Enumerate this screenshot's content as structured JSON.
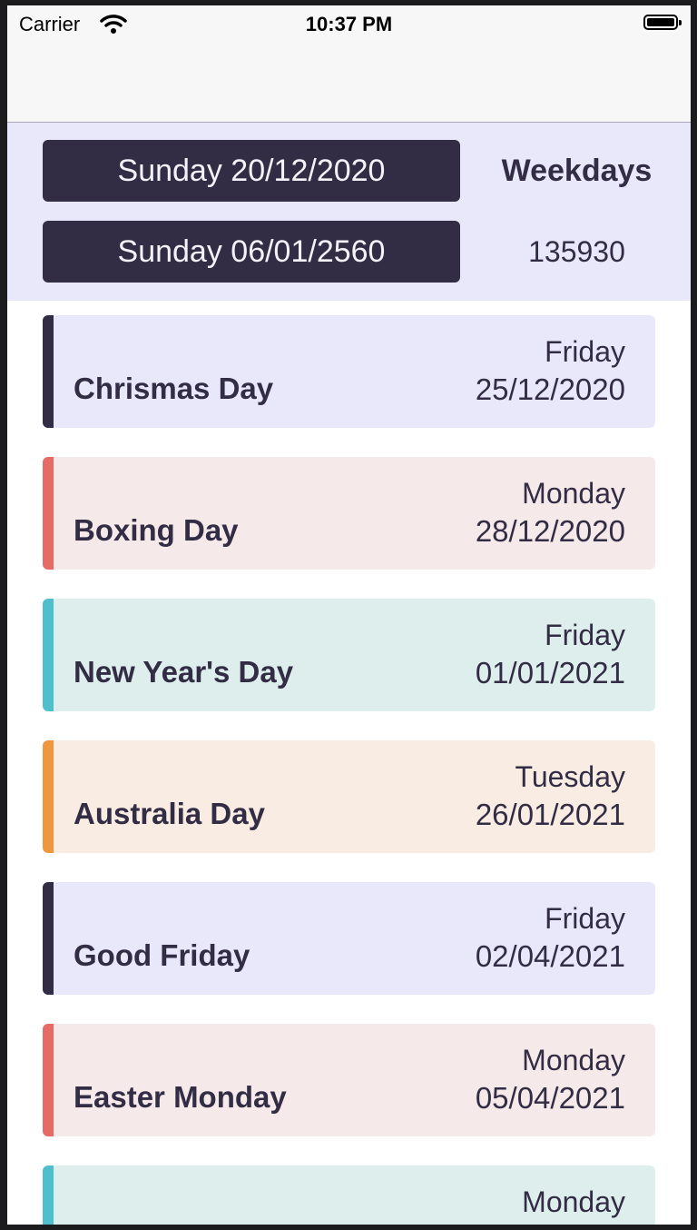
{
  "status_bar": {
    "carrier": "Carrier",
    "time": "10:37 PM"
  },
  "header": {
    "start_date_label": "Sunday 20/12/2020",
    "end_date_label": "Sunday 06/01/2560",
    "weekdays_title": "Weekdays",
    "weekdays_count": "135930"
  },
  "colors": {
    "dark": "#322d45",
    "red": "#e66a66",
    "teal": "#4fbfcc",
    "orange": "#ef973e"
  },
  "holidays": [
    {
      "name": "Chrismas Day",
      "weekday": "Friday",
      "date": "25/12/2020",
      "accent": "#322d45",
      "background": "#e9e8fb"
    },
    {
      "name": "Boxing Day",
      "weekday": "Monday",
      "date": "28/12/2020",
      "accent": "#e66a66",
      "background": "#f6e9ea"
    },
    {
      "name": "New Year's Day",
      "weekday": "Friday",
      "date": "01/01/2021",
      "accent": "#4fbfcc",
      "background": "#deeeed"
    },
    {
      "name": "Australia Day",
      "weekday": "Tuesday",
      "date": "26/01/2021",
      "accent": "#ef973e",
      "background": "#f9ede3"
    },
    {
      "name": "Good Friday",
      "weekday": "Friday",
      "date": "02/04/2021",
      "accent": "#322d45",
      "background": "#e9e8fb"
    },
    {
      "name": "Easter Monday",
      "weekday": "Monday",
      "date": "05/04/2021",
      "accent": "#e66a66",
      "background": "#f6e9ea"
    },
    {
      "name": "",
      "weekday": "Monday",
      "date": "",
      "accent": "#4fbfcc",
      "background": "#deeeed"
    }
  ]
}
